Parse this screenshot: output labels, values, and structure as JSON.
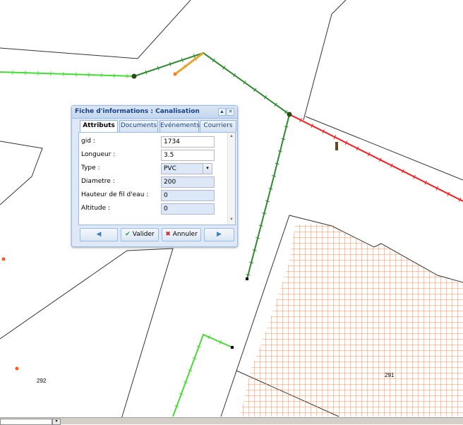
{
  "map": {
    "parcel_labels": [
      "292",
      "291"
    ],
    "colors": {
      "green_pipe": "#2e8b2e",
      "light_green_pipe": "#44dd33",
      "red_pipe": "#ff1a1a",
      "hatch": "#ff6a1a",
      "orange_seg": "#e8a533"
    }
  },
  "dialog": {
    "title": "Fiche d'informations : Canalisation",
    "tabs": [
      "Attributs",
      "Documents",
      "Evénements",
      "Courriers"
    ],
    "active_tab": "Attributs",
    "fields": [
      {
        "label": "gid :",
        "value": "1734"
      },
      {
        "label": "Longueur :",
        "value": "3.5"
      },
      {
        "label": "Type :",
        "value": "PVC"
      },
      {
        "label": "Diametre :",
        "value": "200"
      },
      {
        "label": "Hauteur de fil d'eau :",
        "value": "0"
      },
      {
        "label": "Altitude :",
        "value": "0"
      }
    ],
    "buttons": {
      "validate": "Valider",
      "cancel": "Annuler"
    },
    "icons": {
      "prev": "triangle-left-icon",
      "next": "triangle-right-icon",
      "collapse": "collapse-icon",
      "close": "close-icon"
    }
  }
}
